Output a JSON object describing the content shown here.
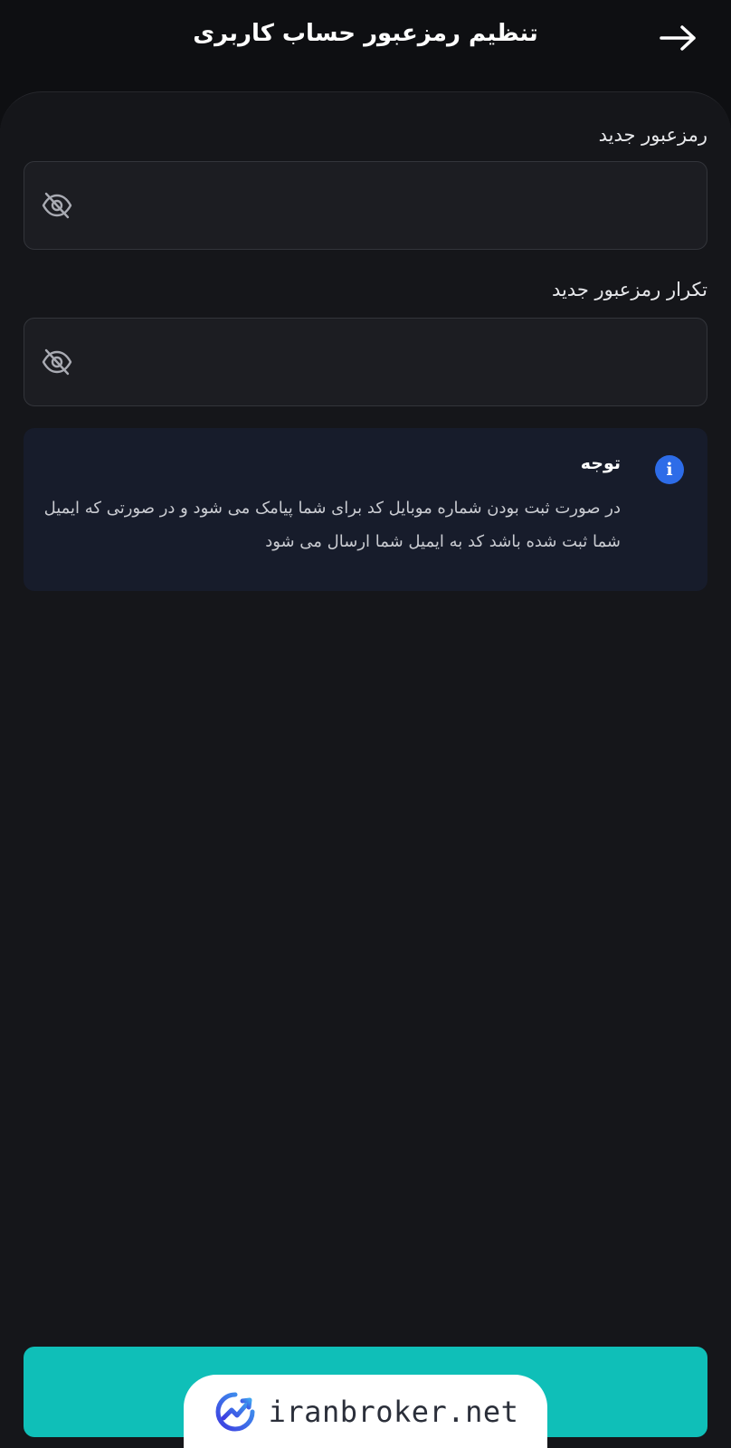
{
  "header": {
    "title": "تنظیم رمزعبور حساب کاربری",
    "back_icon": "arrow-right-icon"
  },
  "form": {
    "new_password": {
      "label": "رمزعبور جدید",
      "value": "",
      "toggle_icon": "eye-off-icon"
    },
    "confirm_password": {
      "label": "تکرار رمزعبور جدید",
      "value": "",
      "toggle_icon": "eye-off-icon"
    }
  },
  "notice": {
    "icon": "info-icon",
    "title": "توجه",
    "body": "در صورت ثبت بودن شماره موبایل کد برای شما پیامک می شود و در صورتی که ایمیل شما ثبت شده باشد کد به ایمیل شما ارسال می شود"
  },
  "watermark": {
    "text": "iranbroker.net",
    "logo_icon": "trend-chart-logo-icon"
  },
  "colors": {
    "background": "#0e0f12",
    "panel": "#15161a",
    "field": "#1c1d22",
    "notice_bg": "#171c2b",
    "accent": "#0fbfb8",
    "info_blue": "#2d6ce8"
  }
}
